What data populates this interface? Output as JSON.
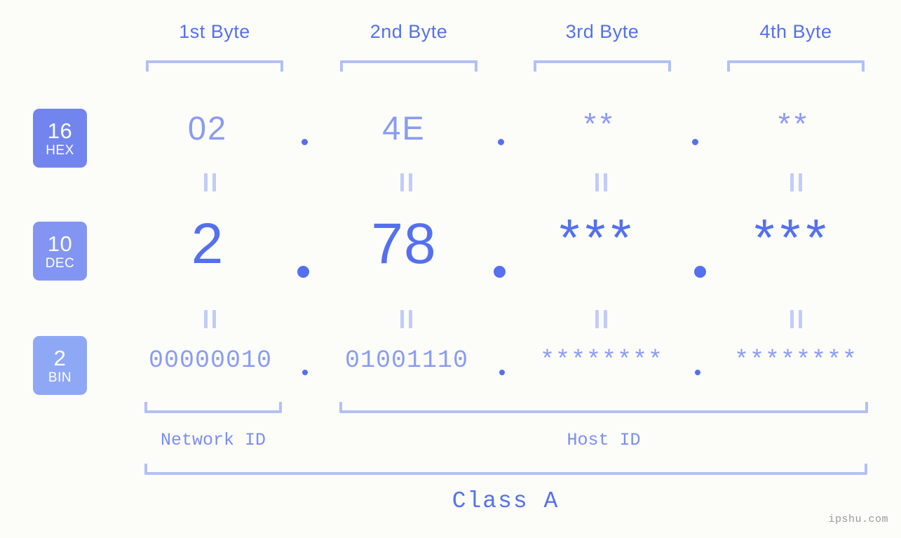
{
  "background_color": "#fcfdf9",
  "accent_strong": "#5570ee",
  "accent_mid": "#8a9cf2",
  "accent_light": "#b3c0f7",
  "headers": [
    {
      "label": "1st Byte"
    },
    {
      "label": "2nd Byte"
    },
    {
      "label": "3rd Byte"
    },
    {
      "label": "4th Byte"
    }
  ],
  "badges": [
    {
      "num": "16",
      "label": "HEX",
      "color": "#7285ef"
    },
    {
      "num": "10",
      "label": "DEC",
      "color": "#8295f2"
    },
    {
      "num": "2",
      "label": "BIN",
      "color": "#8fa8f5"
    }
  ],
  "rows": {
    "hex": {
      "radix": "16",
      "values": [
        "02",
        "4E",
        "**",
        "**"
      ],
      "separator": "."
    },
    "dec": {
      "radix": "10",
      "values": [
        "2",
        "78",
        "***",
        "***"
      ],
      "separator": "."
    },
    "bin": {
      "radix": "2",
      "values": [
        "00000010",
        "01001110",
        "********",
        "********"
      ],
      "separator": "."
    }
  },
  "equals_marks": {
    "glyph": "||",
    "count_per_row": 4
  },
  "segments": {
    "network": {
      "label": "Network ID"
    },
    "host": {
      "label": "Host ID"
    }
  },
  "class": {
    "label": "Class A"
  },
  "watermark": {
    "text": "ipshu.com"
  }
}
